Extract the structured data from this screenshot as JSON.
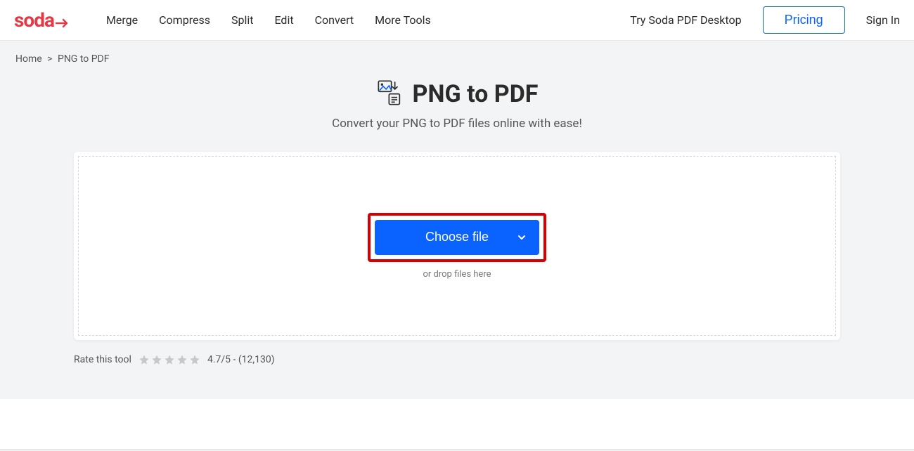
{
  "header": {
    "logo_text": "soda",
    "nav": [
      "Merge",
      "Compress",
      "Split",
      "Edit",
      "Convert",
      "More Tools"
    ],
    "desktop_link": "Try Soda PDF Desktop",
    "pricing": "Pricing",
    "sign_in": "Sign In"
  },
  "breadcrumb": {
    "home": "Home",
    "sep": ">",
    "current": "PNG to PDF"
  },
  "page": {
    "title": "PNG to PDF",
    "subtitle": "Convert your PNG to PDF files online with ease!",
    "choose_file": "Choose file",
    "drop_hint": "or drop files here"
  },
  "rating": {
    "label": "Rate this tool",
    "score": "4.7/5 - (12,130)"
  }
}
